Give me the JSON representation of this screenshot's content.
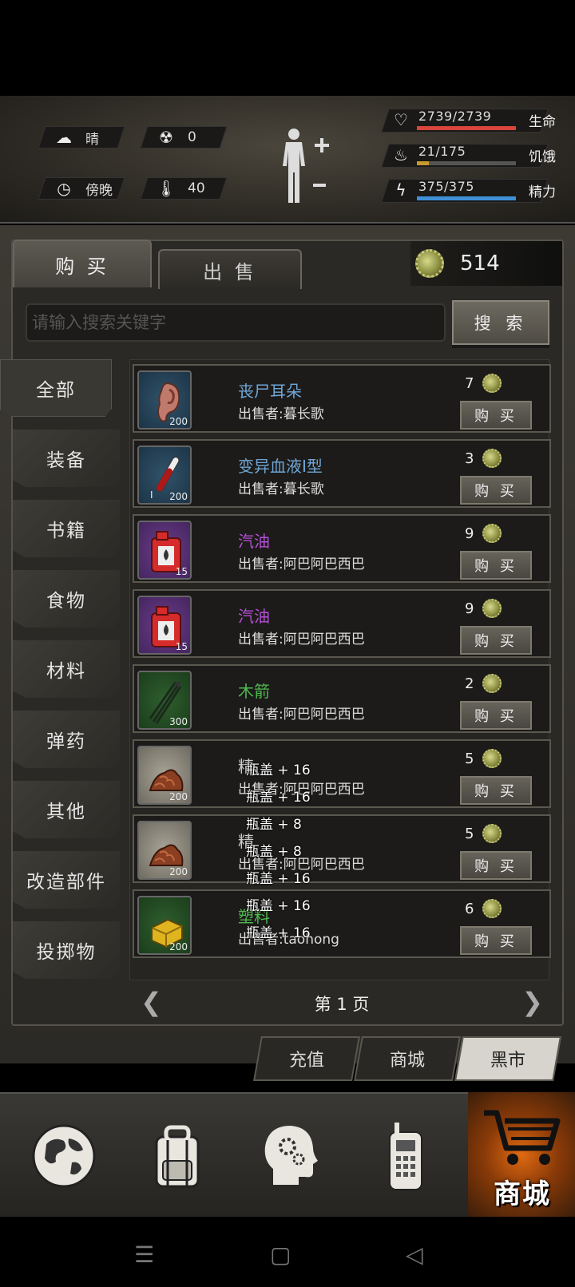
{
  "status": {
    "weather": "晴",
    "radiation": "0",
    "time_of_day": "傍晚",
    "temperature": "40"
  },
  "vitals": [
    {
      "label": "生命",
      "value": "2739/2739",
      "fraction": 1.0,
      "color": "#d9453a",
      "icon": "heart-icon"
    },
    {
      "label": "饥饿",
      "value": "21/175",
      "fraction": 0.12,
      "color": "#c69a2c",
      "icon": "stomach-icon"
    },
    {
      "label": "精力",
      "value": "375/375",
      "fraction": 1.0,
      "color": "#3f8fd6",
      "icon": "energy-icon"
    }
  ],
  "tabs": {
    "buy": "购 买",
    "sell": "出 售"
  },
  "coins": "514",
  "search": {
    "placeholder": "请输入搜索关键字",
    "button": "搜 索"
  },
  "categories": [
    "全部",
    "装备",
    "书籍",
    "食物",
    "材料",
    "弹药",
    "其他",
    "改造部件",
    "投掷物"
  ],
  "items": [
    {
      "name": "丧尸耳朵",
      "name_color": "#6fa6d6",
      "seller": "出售者:暮长歌",
      "qty": "200",
      "price": "7",
      "thumb": "blue",
      "icon": "ear-icon",
      "buy": "购 买"
    },
    {
      "name": "变异血液Ⅰ型",
      "name_color": "#6fa6d6",
      "seller": "出售者:暮长歌",
      "qty": "200",
      "price": "3",
      "thumb": "blue",
      "icon": "blood-vial-icon",
      "buy": "购 买"
    },
    {
      "name": "汽油",
      "name_color": "#b54fd6",
      "seller": "出售者:阿巴阿巴西巴",
      "qty": "15",
      "price": "9",
      "thumb": "purple",
      "icon": "gas-can-icon",
      "buy": "购 买"
    },
    {
      "name": "汽油",
      "name_color": "#b54fd6",
      "seller": "出售者:阿巴阿巴西巴",
      "qty": "15",
      "price": "9",
      "thumb": "purple",
      "icon": "gas-can-icon",
      "buy": "购 买"
    },
    {
      "name": "木箭",
      "name_color": "#4fb84f",
      "seller": "出售者:阿巴阿巴西巴",
      "qty": "300",
      "price": "2",
      "thumb": "green",
      "icon": "arrows-icon",
      "buy": "购 买"
    },
    {
      "name": "精",
      "name_color": "#cccccc",
      "seller": "出售者:阿巴阿巴西巴",
      "qty": "200",
      "price": "5",
      "thumb": "grey",
      "icon": "meat-pile-icon",
      "buy": "购 买"
    },
    {
      "name": "精",
      "name_color": "#cccccc",
      "seller": "出售者:阿巴阿巴西巴",
      "qty": "200",
      "price": "5",
      "thumb": "grey",
      "icon": "meat-pile-icon",
      "buy": "购 买"
    },
    {
      "name": "塑料",
      "name_color": "#4fb84f",
      "seller": "出售者:taohong",
      "qty": "200",
      "price": "6",
      "thumb": "green",
      "icon": "block-icon",
      "buy": "购 买"
    }
  ],
  "overlays": [
    "瓶盖 + 16",
    "瓶盖 + 16",
    "瓶盖 + 8",
    "瓶盖 + 8",
    "瓶盖 + 16",
    "瓶盖 + 16",
    "瓶盖 + 16"
  ],
  "pager": "第 1 页",
  "market_tabs": [
    {
      "label": "充值",
      "active": false
    },
    {
      "label": "商城",
      "active": false
    },
    {
      "label": "黑市",
      "active": true
    }
  ],
  "bottom_nav": {
    "shop_label": "商城"
  }
}
